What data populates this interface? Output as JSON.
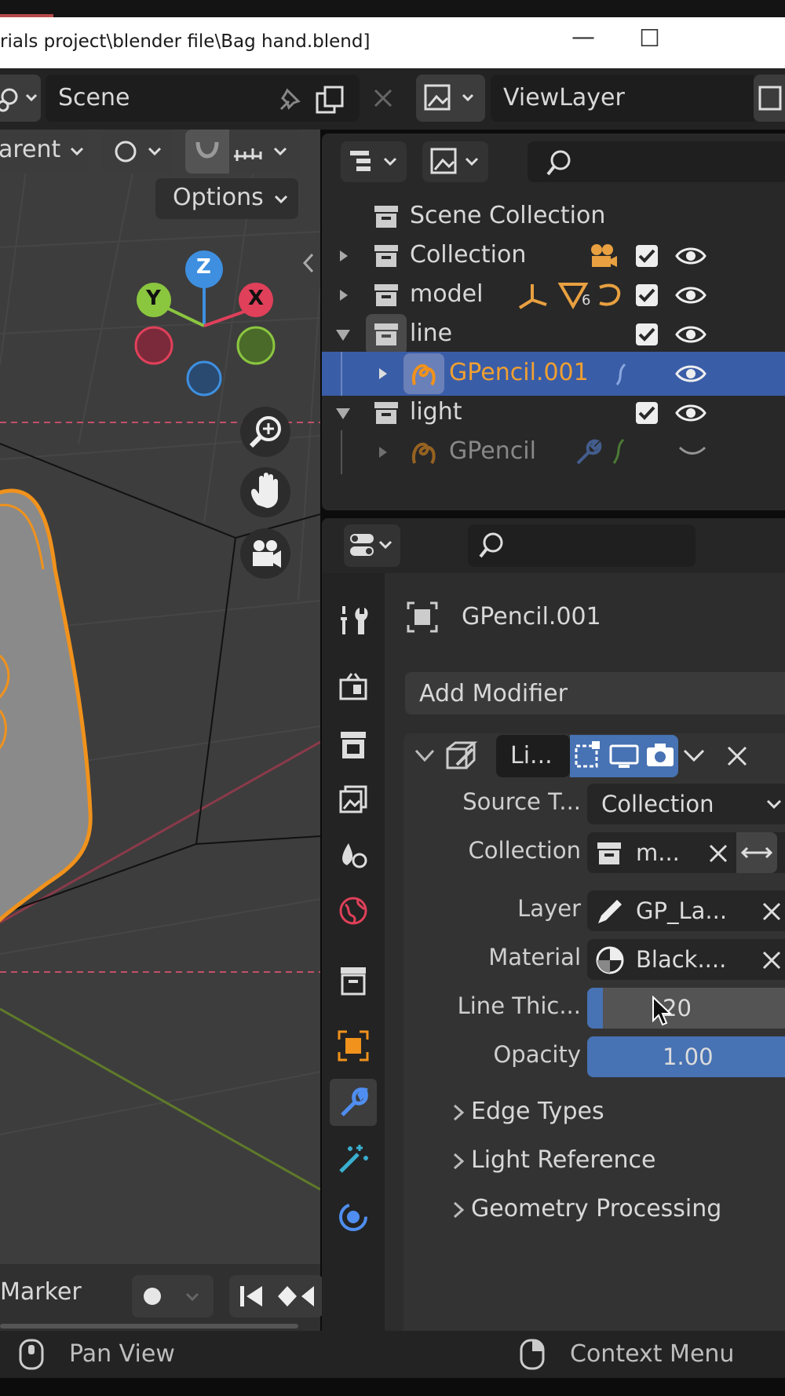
{
  "window": {
    "title": "rials project\\blender file\\Bag hand.blend]",
    "minimize_glyph": "—",
    "maximize_glyph": "☐"
  },
  "header": {
    "scene_label": "Scene",
    "viewlayer_label": "ViewLayer"
  },
  "viewport_header": {
    "transform_label": "arent",
    "options_label": "Options",
    "marker_label": "Marker"
  },
  "gizmo": {
    "z": "Z",
    "y": "Y",
    "x": "X"
  },
  "outliner": {
    "root": "Scene Collection",
    "rows": [
      {
        "label": "Collection",
        "expanded": false
      },
      {
        "label": "model",
        "expanded": false,
        "badge": "6"
      },
      {
        "label": "line",
        "expanded": true
      },
      {
        "label": "GPencil.001",
        "expanded": false,
        "selected": true
      },
      {
        "label": "light",
        "expanded": true
      },
      {
        "label": "GPencil",
        "expanded": false
      }
    ]
  },
  "properties": {
    "object_name": "GPencil.001",
    "add_modifier_label": "Add Modifier",
    "modifier_name": "Li...",
    "fields": {
      "source_type_label": "Source T...",
      "source_type_value": "Collection",
      "collection_label": "Collection",
      "collection_value": "m...",
      "layer_label": "Layer",
      "layer_value": "GP_La...",
      "material_label": "Material",
      "material_value": "Black....",
      "line_thickness_label": "Line Thic...",
      "line_thickness_value": "20",
      "opacity_label": "Opacity",
      "opacity_value": "1.00"
    },
    "sections": [
      "Edge Types",
      "Light Reference",
      "Geometry Processing"
    ]
  },
  "statusbar": {
    "left_hint": "Pan View",
    "right_hint": "Context Menu"
  },
  "colors": {
    "accent_blue": "#4772b3",
    "selection_blue": "#3a5da8",
    "orange_selection": "#f0921c",
    "gizmo_x": "#e0405a",
    "gizmo_y": "#8bc63f",
    "gizmo_z": "#3e8fe0"
  }
}
